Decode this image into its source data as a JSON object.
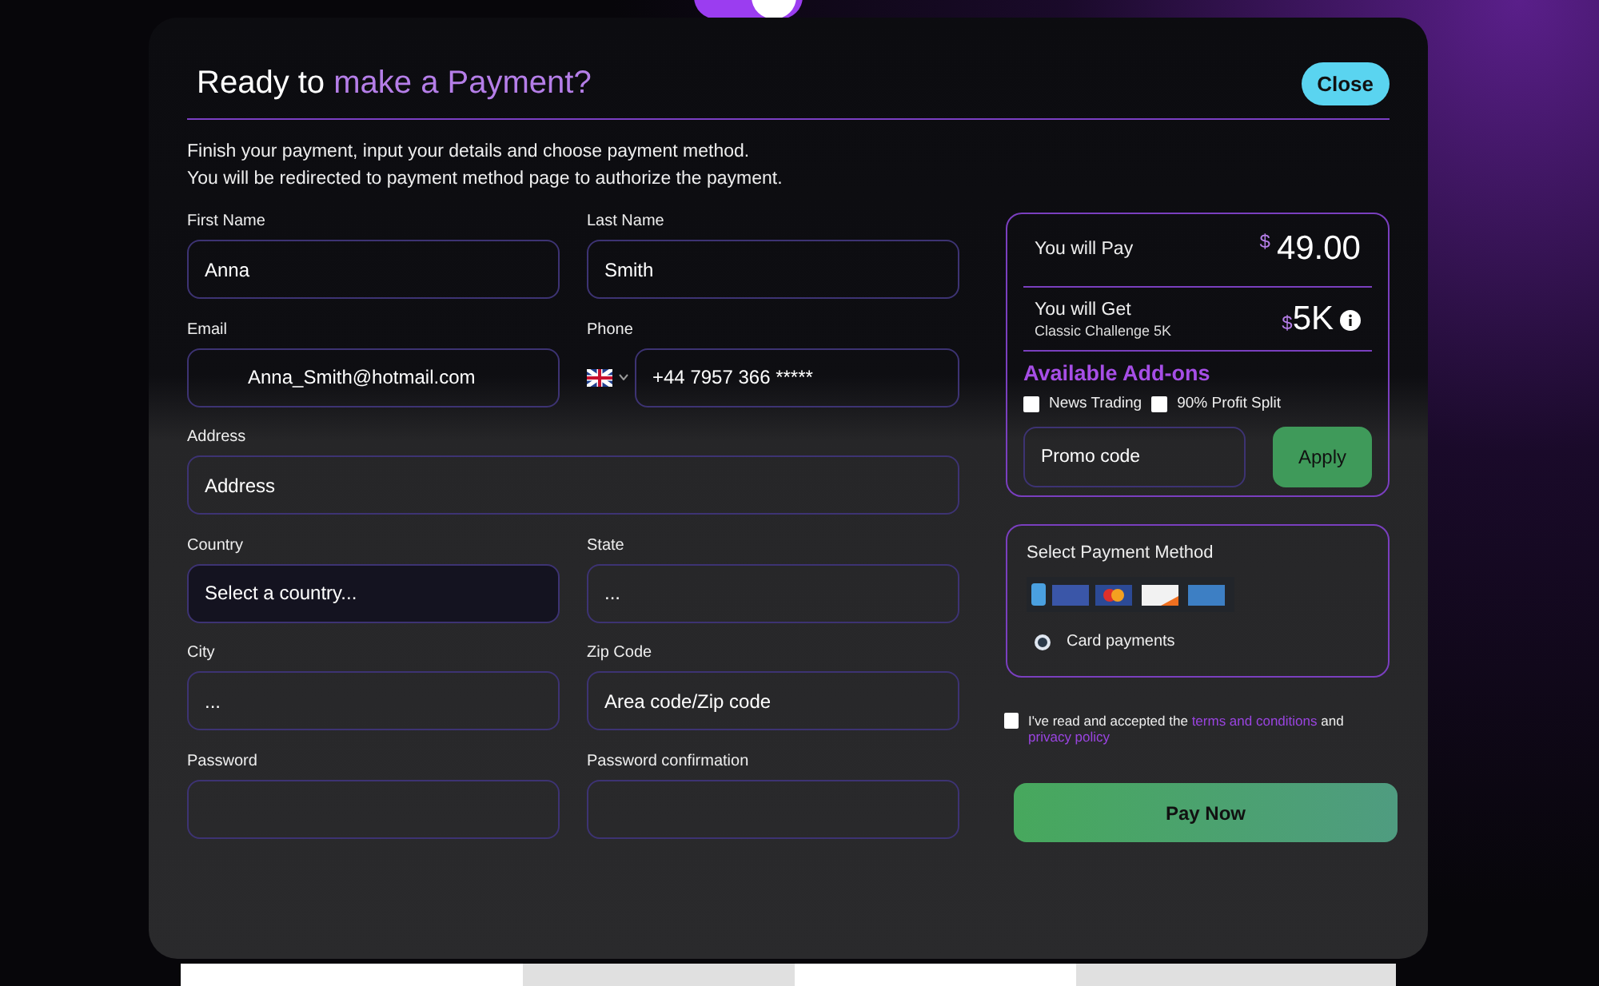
{
  "toggle": {
    "on": true
  },
  "modal": {
    "title_start": "Ready to",
    "title_accent": "make a Payment?",
    "close": "Close",
    "intro": [
      "Finish your payment, input your details and choose payment method.",
      "You will be redirected to payment method page to authorize the payment."
    ],
    "fields": [
      {
        "kind": "text",
        "label": "First Name",
        "value": "Anna"
      },
      {
        "kind": "text",
        "label": "Last Name",
        "value": "Smith"
      },
      {
        "kind": "email",
        "label": "Email",
        "value": "Anna_Smith@hotmail.com"
      },
      {
        "kind": "phone",
        "label": "Phone",
        "value": "+44 7957 366 *****"
      },
      {
        "kind": "wide",
        "label": "Address",
        "placeholder": "Address"
      },
      {
        "kind": "select",
        "label": "Country",
        "value": "Select a country..."
      },
      {
        "kind": "text",
        "label": "State",
        "value": "..."
      },
      {
        "kind": "text",
        "label": "City",
        "value": "..."
      },
      {
        "kind": "text",
        "label": "Zip Code",
        "placeholder": "Area code/Zip code"
      },
      {
        "kind": "password",
        "label": "Password"
      },
      {
        "kind": "password",
        "label": "Password confirmation"
      }
    ],
    "summary": {
      "pay_label": "You will Pay",
      "pay_currency": "$",
      "pay_amount": "49.00",
      "get_label": "You will Get",
      "get_sub": "Classic Challenge 5K",
      "get_currency": "$",
      "get_amount": "5K",
      "addons_title": "Available Add-ons",
      "addons": [
        {
          "label": "News Trading",
          "checked": false
        },
        {
          "label": "90% Profit Split",
          "checked": false
        }
      ],
      "promo_placeholder": "Promo code",
      "apply": "Apply"
    },
    "payment": {
      "title": "Select Payment Method",
      "methods": [
        {
          "label": "Card payments",
          "selected": true
        }
      ]
    },
    "terms": {
      "checked": false,
      "before": "I've read and accepted the",
      "link1": "terms and conditions",
      "middle": "and",
      "link2": "privacy policy"
    },
    "pay_button": "Pay Now"
  }
}
